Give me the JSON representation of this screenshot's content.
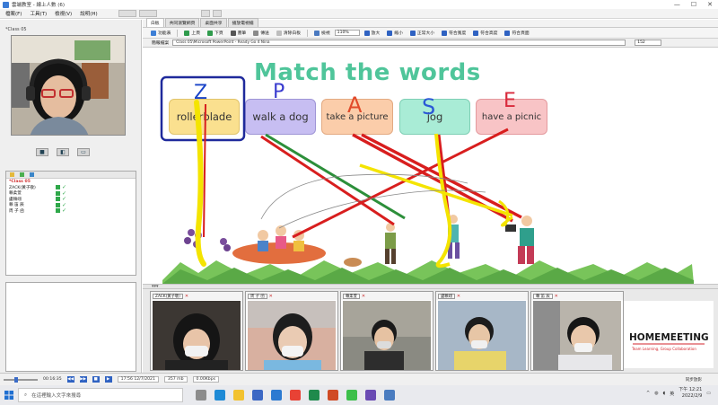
{
  "window": {
    "title": "雲端教室 - 線上人數 (6)"
  },
  "menu": [
    "檔案(F)",
    "工具(T)",
    "檢視(V)",
    "說明(H)"
  ],
  "left_panel": {
    "video_header": "*Class 05",
    "user_list": [
      {
        "name": "*Class 05",
        "is_class": true
      },
      {
        "name": "ZACK(黃子敬)",
        "is_class": false
      },
      {
        "name": "賴柔萱",
        "is_class": false
      },
      {
        "name": "盧賴翊",
        "is_class": false
      },
      {
        "name": "賴 笛 辰",
        "is_class": false
      },
      {
        "name": "周 子 函",
        "is_class": false
      }
    ]
  },
  "tabs": [
    "白板",
    "共同瀏覽網頁",
    "桌面共享",
    "播放電視檔"
  ],
  "toolbar": {
    "items": [
      "功能表",
      "上頁",
      "下頁",
      "畫筆",
      "傳送",
      "清除白板",
      "檢視",
      "放大",
      "縮小",
      "正常大小",
      "符合寬度",
      "符合高度",
      "符合頁面"
    ],
    "zoom": "110%"
  },
  "address": {
    "label": "簡報檔案",
    "path": "Class 05\\Microsoft PowerPoint - Ready Go 4 Nina",
    "page": "152"
  },
  "slide": {
    "title": "Match the words",
    "words": [
      "rollerblade",
      "walk a dog",
      "take a picture",
      "jog",
      "have a picnic"
    ],
    "word_colors": [
      "#fae08f",
      "#c7bef2",
      "#fbcdaa",
      "#a9ecd6",
      "#f8c4c6"
    ],
    "letters": [
      "Z",
      "P",
      "A",
      "S",
      "E"
    ]
  },
  "students": [
    {
      "name": "ZACK(黃子敬)"
    },
    {
      "name": "周 子 函"
    },
    {
      "name": "賴柔萱"
    },
    {
      "name": "盧賴翊"
    },
    {
      "name": "賴 笛 辰"
    }
  ],
  "logo": {
    "brand": "HOMEMEETING",
    "tagline": "Team Learning, Group Collaboration"
  },
  "status": {
    "time": "00:16:35",
    "date_text": "17:56 12/7/2021",
    "size": "357 mb",
    "bitrate": "0.00Kbps",
    "right_label": "同步放影"
  },
  "taskbar": {
    "search_placeholder": "在這裡輸入文字來搜尋",
    "lang": "英",
    "time": "下午 12:21",
    "date": "2022/2/9"
  }
}
